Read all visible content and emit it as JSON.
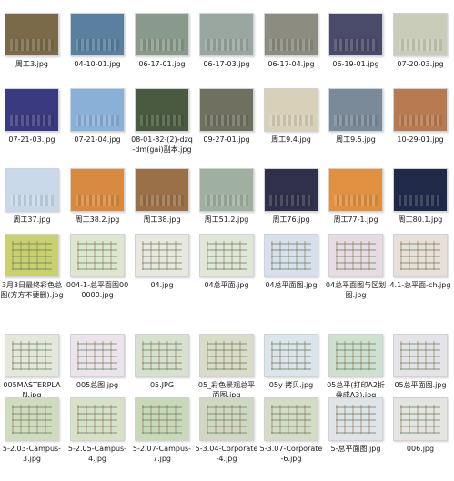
{
  "files": [
    {
      "name": "周工3.jpg",
      "thumb": "#7a6a4a"
    },
    {
      "name": "04-10-01.jpg",
      "thumb": "#5a7f9f"
    },
    {
      "name": "06-17-01.jpg",
      "thumb": "#8a9a8a"
    },
    {
      "name": "06-17-03.jpg",
      "thumb": "#9aa6a0"
    },
    {
      "name": "06-17-04.jpg",
      "thumb": "#8c8c80"
    },
    {
      "name": "06-19-01.jpg",
      "thumb": "#4a4a6a"
    },
    {
      "name": "07-20-03.jpg",
      "thumb": "#c8ccb8"
    },
    {
      "name": "07-21-03.jpg",
      "thumb": "#3a3a80"
    },
    {
      "name": "07-21-04.jpg",
      "thumb": "#8ab0d8"
    },
    {
      "name": "08-01-82-(2)-dzq-dm(gai)副本.jpg",
      "thumb": "#4a5a40"
    },
    {
      "name": "09-27-01.jpg",
      "thumb": "#707060"
    },
    {
      "name": "周工9.4.jpg",
      "thumb": "#d8d0b8"
    },
    {
      "name": "周工9.5.jpg",
      "thumb": "#7a8a98"
    },
    {
      "name": "10-29-01.jpg",
      "thumb": "#b87a50"
    },
    {
      "name": "周工37.jpg",
      "thumb": "#c8d8e8"
    },
    {
      "name": "周工38.2.jpg",
      "thumb": "#d88a40"
    },
    {
      "name": "周工38.jpg",
      "thumb": "#9a7048"
    },
    {
      "name": "周工51.2.jpg",
      "thumb": "#a0b0a0"
    },
    {
      "name": "周工76.jpg",
      "thumb": "#30304a"
    },
    {
      "name": "周工77-1.jpg",
      "thumb": "#e09040"
    },
    {
      "name": "周工80.1.jpg",
      "thumb": "#202a48"
    },
    {
      "name": "3月3日最终彩色总图(方方不要删).jpg",
      "thumb": "#c8d070",
      "plan": true
    },
    {
      "name": "004-1-总平面图000000.jpg",
      "thumb": "#dfe6d0",
      "plan": true
    },
    {
      "name": "04.jpg",
      "thumb": "#e8e8e0",
      "plan": true
    },
    {
      "name": "04总平面.jpg",
      "thumb": "#e0e6d8",
      "plan": true
    },
    {
      "name": "04总平面图.jpg",
      "thumb": "#d8e0ee",
      "plan": true
    },
    {
      "name": "04总平面图与区划图.jpg",
      "thumb": "#e8dce4",
      "plan": true
    },
    {
      "name": "4.1-总平面-ch.jpg",
      "thumb": "#e8e0d8",
      "plan": true
    },
    {
      "name": "005MASTERPLAN.jpg",
      "thumb": "#e4e8dc",
      "plan": true
    },
    {
      "name": "005总图.jpg",
      "thumb": "#ece4ec",
      "plan": true
    },
    {
      "name": "05.JPG",
      "thumb": "#d8e0d0",
      "plan": true
    },
    {
      "name": "05_彩色景观总平面图.jpg",
      "thumb": "#d8dcc8",
      "plan": true
    },
    {
      "name": "05y 拷贝.jpg",
      "thumb": "#dce4ec",
      "plan": true
    },
    {
      "name": "05总平(打印A2折叠成A3).jpg",
      "thumb": "#d0e0d0",
      "plan": true
    },
    {
      "name": "05总平面图.jpg",
      "thumb": "#e4e4e8",
      "plan": true
    },
    {
      "name": "5-2.03-Campus-3.jpg",
      "thumb": "#d0dcc0",
      "plan": true
    },
    {
      "name": "5-2.05-Campus-4.jpg",
      "thumb": "#d8e0c8",
      "plan": true
    },
    {
      "name": "5-2.07-Campus-7.jpg",
      "thumb": "#c8d8b8",
      "plan": true
    },
    {
      "name": "5-3.04-Corporate-4.jpg",
      "thumb": "#d0d8c4",
      "plan": true
    },
    {
      "name": "5-3.07-Corporate-6.jpg",
      "thumb": "#d4dcc8",
      "plan": true
    },
    {
      "name": "5-总平面图.jpg",
      "thumb": "#e0e4e8",
      "plan": true
    },
    {
      "name": "006.jpg",
      "thumb": "#e4e4e0",
      "plan": true
    }
  ]
}
